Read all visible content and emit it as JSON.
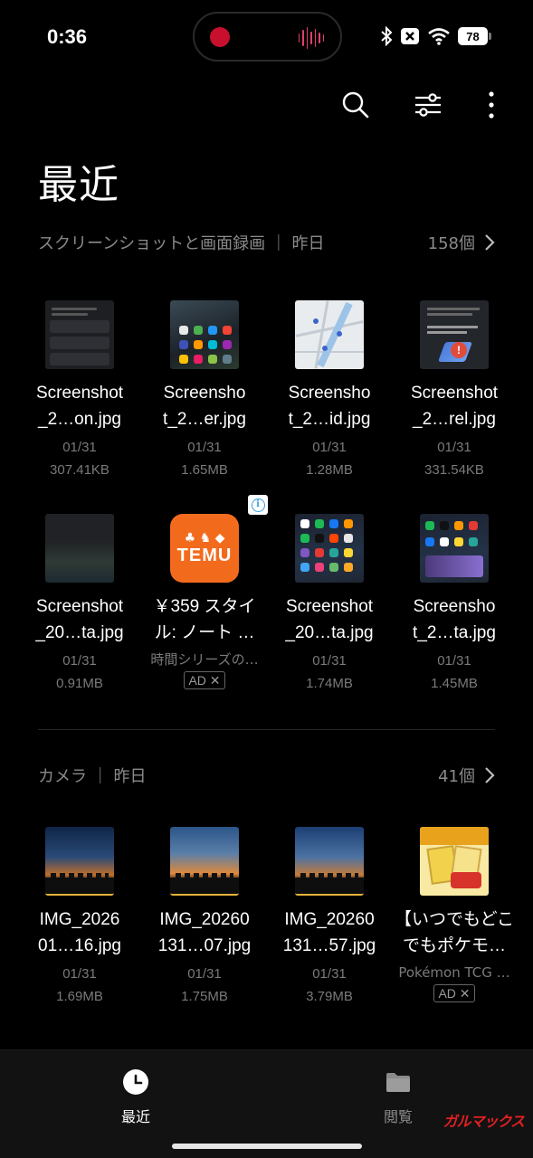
{
  "status_bar": {
    "time": "0:36",
    "battery": "78"
  },
  "page_title": "最近",
  "sections": [
    {
      "title": "スクリーンショットと画面録画 ｜ 昨日",
      "count": "158個",
      "items": [
        {
          "name_line1": "Screenshot",
          "name_line2": "_2…on.jpg",
          "date": "01/31",
          "size": "307.41KB"
        },
        {
          "name_line1": "Screensho",
          "name_line2": "t_2…er.jpg",
          "date": "01/31",
          "size": "1.65MB"
        },
        {
          "name_line1": "Screensho",
          "name_line2": "t_2…id.jpg",
          "date": "01/31",
          "size": "1.28MB"
        },
        {
          "name_line1": "Screenshot",
          "name_line2": "_2…rel.jpg",
          "date": "01/31",
          "size": "331.54KB"
        },
        {
          "name_line1": "Screenshot",
          "name_line2": "_20…ta.jpg",
          "date": "01/31",
          "size": "0.91MB"
        },
        {
          "name_line1": "Screenshot",
          "name_line2": "_20…ta.jpg",
          "date": "01/31",
          "size": "1.74MB"
        },
        {
          "name_line1": "Screensho",
          "name_line2": "t_2…ta.jpg",
          "date": "01/31",
          "size": "1.45MB"
        }
      ],
      "ad": {
        "logo_text": "TEMU",
        "line1": "￥359 スタイ",
        "line2": "ル: ノート …",
        "sub": "時間シリーズの…",
        "badge": "AD ✕"
      }
    },
    {
      "title": "カメラ ｜ 昨日",
      "count": "41個",
      "items": [
        {
          "name_line1": "IMG_2026",
          "name_line2": "01…16.jpg",
          "date": "01/31",
          "size": "1.69MB"
        },
        {
          "name_line1": "IMG_20260",
          "name_line2": "131…07.jpg",
          "date": "01/31",
          "size": "1.75MB"
        },
        {
          "name_line1": "IMG_20260",
          "name_line2": "131…57.jpg",
          "date": "01/31",
          "size": "3.79MB"
        }
      ],
      "ad": {
        "line1": "【いつでもどこ",
        "line2": "でもポケモ…",
        "sub": "Pokémon TCG …",
        "badge": "AD ✕"
      }
    }
  ],
  "bottom_nav": {
    "recent": "最近",
    "browse": "閲覧"
  },
  "watermark": "ガルマックス",
  "icons": {
    "search": "search-icon",
    "filter": "filter-sliders-icon",
    "more": "more-vertical-icon",
    "recent": "clock-icon",
    "browse": "folder-icon"
  }
}
